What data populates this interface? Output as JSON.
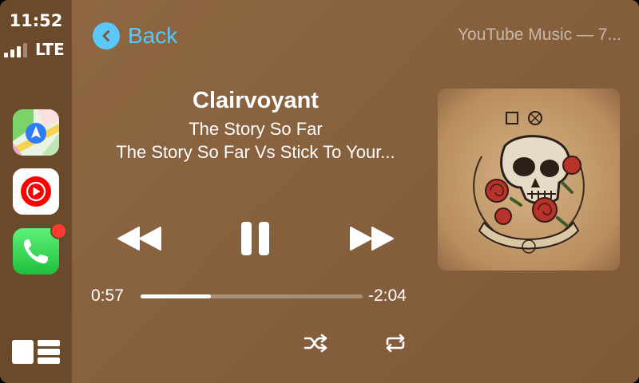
{
  "status": {
    "time": "11:52",
    "network": "LTE",
    "signal_bars": 3
  },
  "sidebar": {
    "apps": [
      {
        "name": "Maps",
        "icon": "maps-icon"
      },
      {
        "name": "YouTube Music",
        "icon": "youtube-music-icon"
      },
      {
        "name": "Phone",
        "icon": "phone-icon",
        "has_notification": true
      }
    ],
    "dashboard_icon": "dashboard-icon"
  },
  "header": {
    "back_label": "Back",
    "source": "YouTube Music — 7..."
  },
  "track": {
    "title": "Clairvoyant",
    "artist": "The Story So Far",
    "album": "The Story So Far Vs Stick To Your..."
  },
  "playback": {
    "elapsed": "0:57",
    "remaining": "-2:04",
    "progress": 0.317,
    "state": "playing"
  },
  "controls": {
    "rewind_icon": "rewind-icon",
    "pause_icon": "pause-icon",
    "forward_icon": "fast-forward-icon",
    "shuffle_icon": "shuffle-icon",
    "repeat_icon": "repeat-icon"
  },
  "colors": {
    "accent": "#5ac8fa",
    "background": "#86603d",
    "sidebar": "#6b4a2c",
    "notification": "#ff3b30"
  }
}
